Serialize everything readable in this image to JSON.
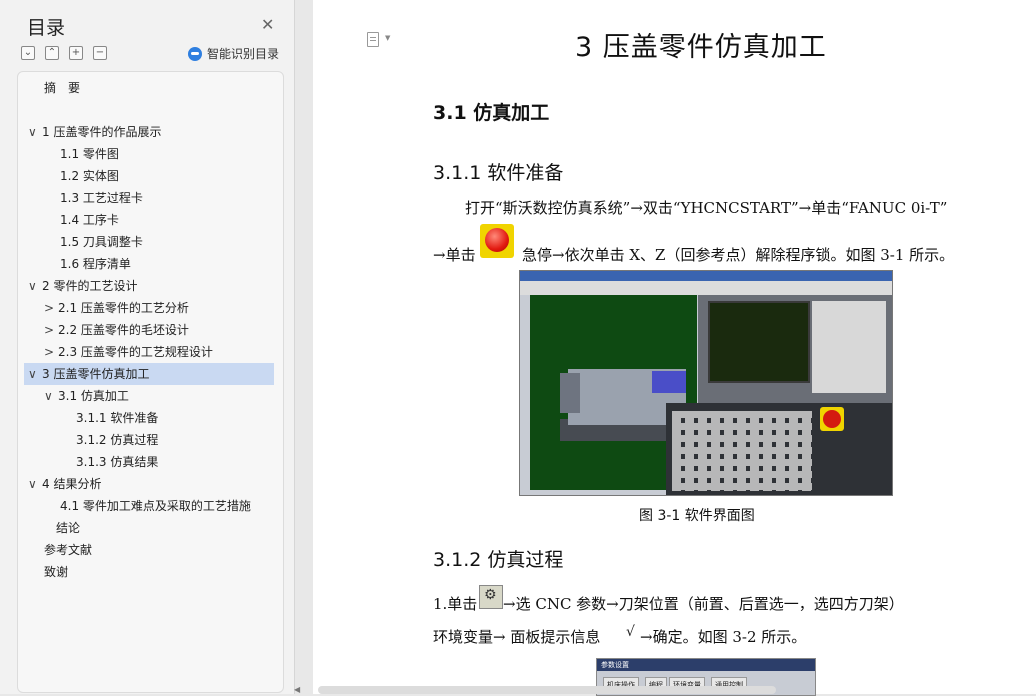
{
  "toc": {
    "title": "目录",
    "smart_toc_label": "智能识别目录",
    "items": [
      {
        "label": "摘　要",
        "chevron": ""
      },
      {
        "label": "1 压盖零件的作品展示",
        "chevron": "∨"
      },
      {
        "label": "1.1 零件图",
        "chevron": ""
      },
      {
        "label": "1.2 实体图",
        "chevron": ""
      },
      {
        "label": "1.3 工艺过程卡",
        "chevron": ""
      },
      {
        "label": "1.4 工序卡",
        "chevron": ""
      },
      {
        "label": "1.5 刀具调整卡",
        "chevron": ""
      },
      {
        "label": "1.6 程序清单",
        "chevron": ""
      },
      {
        "label": "2 零件的工艺设计",
        "chevron": "∨"
      },
      {
        "label": "2.1 压盖零件的工艺分析",
        "chevron": ">"
      },
      {
        "label": "2.2  压盖零件的毛坯设计",
        "chevron": ">"
      },
      {
        "label": "2.3  压盖零件的工艺规程设计",
        "chevron": ">"
      },
      {
        "label": "3  压盖零件仿真加工",
        "chevron": "∨"
      },
      {
        "label": "3.1 仿真加工",
        "chevron": "∨"
      },
      {
        "label": "3.1.1 软件准备",
        "chevron": ""
      },
      {
        "label": "3.1.2 仿真过程",
        "chevron": ""
      },
      {
        "label": "3.1.3 仿真结果",
        "chevron": ""
      },
      {
        "label": "4  结果分析",
        "chevron": "∨"
      },
      {
        "label": "4.1 零件加工难点及采取的工艺措施",
        "chevron": ""
      },
      {
        "label": "结论",
        "chevron": ""
      },
      {
        "label": "参考文献",
        "chevron": ""
      },
      {
        "label": "致谢",
        "chevron": ""
      }
    ]
  },
  "doc": {
    "chapter_title": "3  压盖零件仿真加工",
    "section_title": "3.1 仿真加工",
    "sub1_title": "3.1.1 软件准备",
    "p1_line1": "打开“斯沃数控仿真系统”→双击“YHCNCSTART”→单击“FANUC 0i-T”",
    "p1_line2_a": "→单击",
    "p1_line2_b": "急停→依次单击 X、Z（回参考点）解除程序锁。如图 3-1 所示。",
    "figure_caption": "图 3-1  软件界面图",
    "sub2_title": "3.1.2 仿真过程",
    "p2_line1_a": "1.单击",
    "p2_line1_b": "→选 CNC 参数→刀架位置（前置、后置选一，选四方刀架）",
    "p2_line2": "环境变量→  面板提示信息",
    "p2_line2_b": "→确定。如图 3-2 所示。",
    "check_glyph": "√",
    "fig2_title": "参数设置",
    "fig2_tabs": [
      "机床操作",
      "编程",
      "环境变量",
      "通用控制"
    ]
  }
}
